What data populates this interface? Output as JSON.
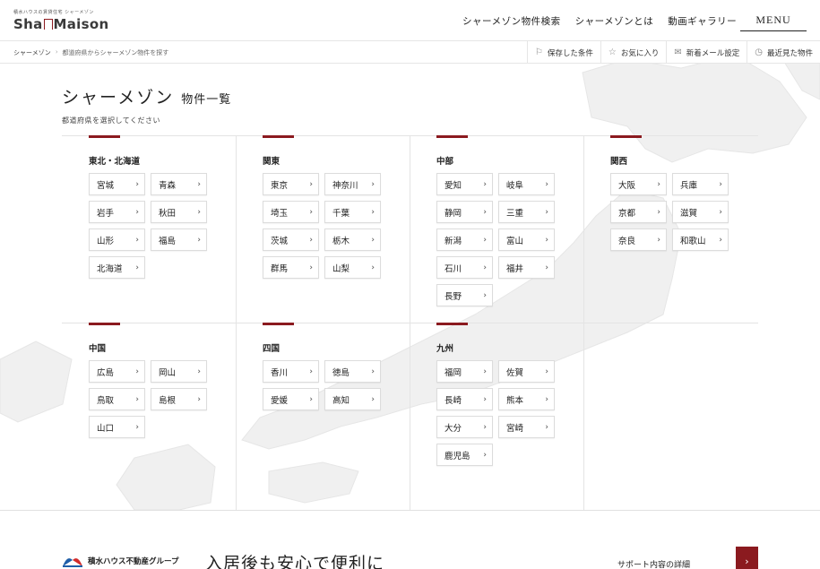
{
  "header": {
    "logo_tagline": "積水ハウスの賃貸住宅 シャーメゾン",
    "logo_pre": "Sha",
    "logo_post": "Maison",
    "nav": [
      "シャーメゾン物件検索",
      "シャーメゾンとは",
      "動画ギャラリー"
    ],
    "menu_label": "MENU"
  },
  "subbar": {
    "breadcrumb": [
      "シャーメゾン",
      "都道府県からシャーメゾン物件を探す"
    ],
    "breadcrumb_sep": "›",
    "utilities": [
      {
        "icon": "bookmark-icon",
        "glyph": "⚐",
        "label": "保存した条件"
      },
      {
        "icon": "star-icon",
        "glyph": "☆",
        "label": "お気に入り"
      },
      {
        "icon": "mail-icon",
        "glyph": "✉",
        "label": "新着メール設定"
      },
      {
        "icon": "clock-icon",
        "glyph": "◷",
        "label": "最近見た物件"
      }
    ]
  },
  "page": {
    "title": "シャーメゾン",
    "title_small": "物件一覧",
    "subtitle": "都道府県を選択してください"
  },
  "regions": [
    {
      "name": "東北・北海道",
      "prefs": [
        "宮城",
        "青森",
        "岩手",
        "秋田",
        "山形",
        "福島",
        "北海道"
      ]
    },
    {
      "name": "関東",
      "prefs": [
        "東京",
        "神奈川",
        "埼玉",
        "千葉",
        "茨城",
        "栃木",
        "群馬",
        "山梨"
      ]
    },
    {
      "name": "中部",
      "prefs": [
        "愛知",
        "岐阜",
        "静岡",
        "三重",
        "新潟",
        "富山",
        "石川",
        "福井",
        "長野"
      ]
    },
    {
      "name": "関西",
      "prefs": [
        "大阪",
        "兵庫",
        "京都",
        "滋賀",
        "奈良",
        "和歌山"
      ]
    },
    {
      "name": "中国",
      "prefs": [
        "広島",
        "岡山",
        "鳥取",
        "島根",
        "山口"
      ]
    },
    {
      "name": "四国",
      "prefs": [
        "香川",
        "徳島",
        "愛媛",
        "高知"
      ]
    },
    {
      "name": "九州",
      "prefs": [
        "福岡",
        "佐賀",
        "長崎",
        "熊本",
        "大分",
        "宮崎",
        "鹿児島"
      ]
    }
  ],
  "chevron": "›",
  "footer": {
    "group_name": "積水ハウス不動産グループ",
    "heading": "入居後も安心で便利に",
    "support_label": "サポート内容の詳細",
    "support_arrow": "›"
  },
  "colors": {
    "accent": "#8b1a1f",
    "border": "#dcdcdc",
    "map": "#f0f0f0"
  }
}
